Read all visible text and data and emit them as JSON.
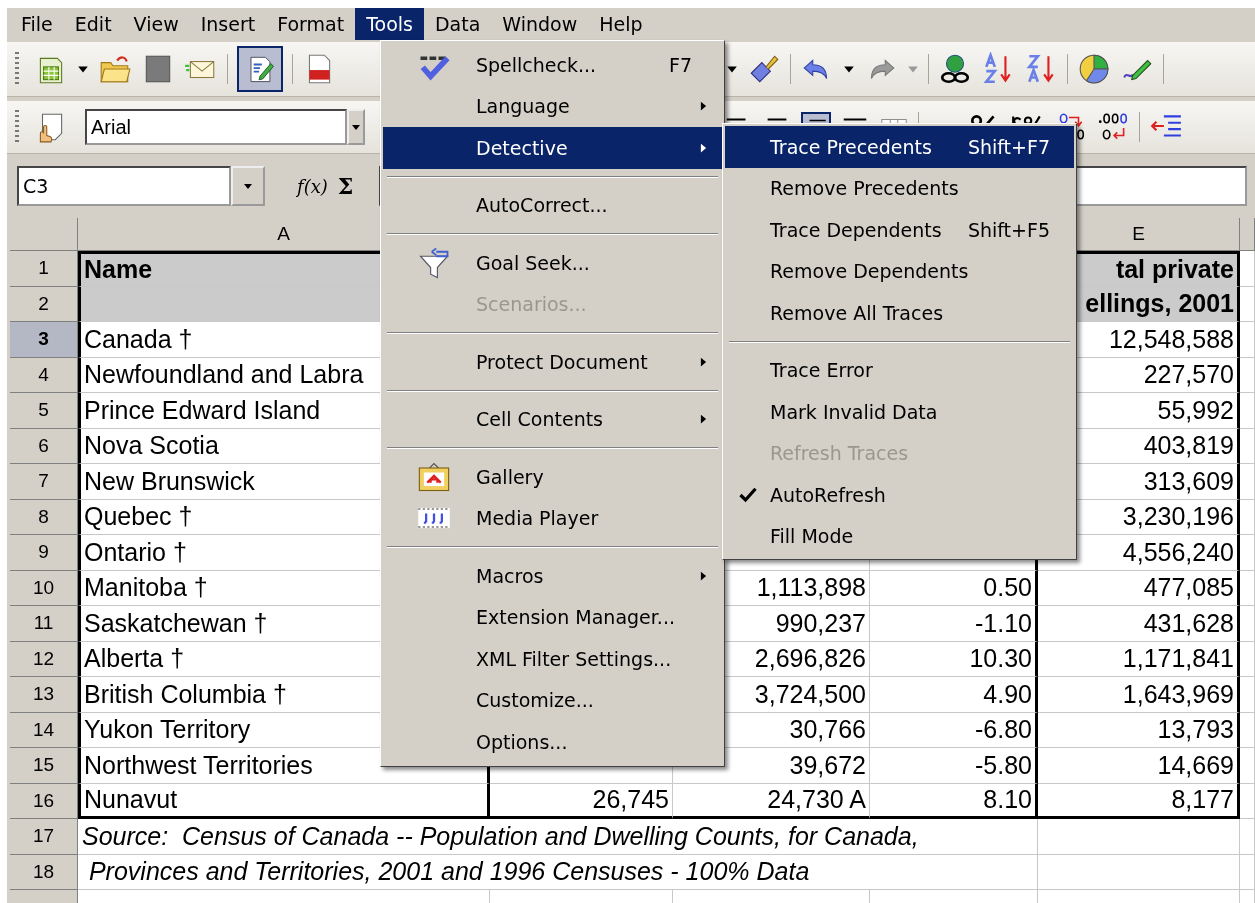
{
  "menubar": [
    {
      "label": "File",
      "selected": false
    },
    {
      "label": "Edit",
      "selected": false
    },
    {
      "label": "View",
      "selected": false
    },
    {
      "label": "Insert",
      "selected": false
    },
    {
      "label": "Format",
      "selected": false
    },
    {
      "label": "Tools",
      "selected": true
    },
    {
      "label": "Data",
      "selected": false
    },
    {
      "label": "Window",
      "selected": false
    },
    {
      "label": "Help",
      "selected": false
    }
  ],
  "standard_toolbar": {
    "edit_file_pressed": true,
    "redo_disabled": true
  },
  "formatting_toolbar": {
    "font_name": "Arial"
  },
  "formula_bar": {
    "name_box": "C3",
    "function_wizard": "f(x)",
    "sum_symbol": "Σ"
  },
  "column_headers": {
    "a": "A",
    "e": "E"
  },
  "rows": [
    {
      "header": "1",
      "selected": false,
      "kind": "heading",
      "a": "Name",
      "e": "tal private"
    },
    {
      "header": "2",
      "selected": false,
      "kind": "heading",
      "e": "ellings, 2001"
    },
    {
      "header": "3",
      "selected": true,
      "kind": "data",
      "a": "Canada †",
      "e": "12,548,588"
    },
    {
      "header": "4",
      "selected": false,
      "kind": "data",
      "a": "Newfoundland and Labra",
      "e": "227,570"
    },
    {
      "header": "5",
      "selected": false,
      "kind": "data",
      "a": "Prince Edward Island",
      "e": "55,992"
    },
    {
      "header": "6",
      "selected": false,
      "kind": "data",
      "a": "Nova Scotia",
      "e": "403,819"
    },
    {
      "header": "7",
      "selected": false,
      "kind": "data",
      "a": "New Brunswick",
      "e": "313,609"
    },
    {
      "header": "8",
      "selected": false,
      "kind": "data",
      "a": "Quebec †",
      "e": "3,230,196"
    },
    {
      "header": "9",
      "selected": false,
      "kind": "data",
      "a": "Ontario †",
      "e": "4,556,240"
    },
    {
      "header": "10",
      "selected": false,
      "kind": "data",
      "a": "Manitoba †",
      "c": "1,113,898",
      "d": "0.50",
      "e": "477,085"
    },
    {
      "header": "11",
      "selected": false,
      "kind": "data",
      "a": "Saskatchewan †",
      "c": "990,237",
      "d": "-1.10",
      "e": "431,628"
    },
    {
      "header": "12",
      "selected": false,
      "kind": "data",
      "a": "Alberta †",
      "c": "2,696,826",
      "d": "10.30",
      "e": "1,171,841"
    },
    {
      "header": "13",
      "selected": false,
      "kind": "data",
      "a": "British Columbia †",
      "c": "3,724,500",
      "d": "4.90",
      "e": "1,643,969"
    },
    {
      "header": "14",
      "selected": false,
      "kind": "data",
      "a": "Yukon Territory",
      "c": "30,766",
      "d": "-6.80",
      "e": "13,793"
    },
    {
      "header": "15",
      "selected": false,
      "kind": "data",
      "a": "Northwest Territories",
      "c": "39,672",
      "d": "-5.80",
      "e": "14,669"
    },
    {
      "header": "16",
      "selected": false,
      "kind": "data",
      "a": "Nunavut",
      "b": "26,745",
      "c": "24,730 A",
      "d": "8.10",
      "e": "8,177"
    },
    {
      "header": "17",
      "selected": false,
      "kind": "note",
      "a": "Source:  Census of Canada -- Population and Dwelling Counts, for Canada,"
    },
    {
      "header": "18",
      "selected": false,
      "kind": "note",
      "a": " Provinces and Territories, 2001 and 1996 Censuses - 100% Data"
    }
  ],
  "tools_menu": {
    "groups": [
      {
        "items": [
          {
            "label": "Spellcheck...",
            "shortcut": "F7",
            "has_submenu": false,
            "selected": false,
            "disabled": false
          },
          {
            "label": "Language",
            "has_submenu": true,
            "selected": false,
            "disabled": false
          },
          {
            "label": "Detective",
            "has_submenu": true,
            "selected": true,
            "disabled": false
          }
        ]
      },
      {
        "items": [
          {
            "label": "AutoCorrect...",
            "has_submenu": false,
            "selected": false,
            "disabled": false
          }
        ]
      },
      {
        "items": [
          {
            "label": "Goal Seek...",
            "has_submenu": false,
            "selected": false,
            "disabled": false
          },
          {
            "label": "Scenarios...",
            "has_submenu": false,
            "selected": false,
            "disabled": true
          }
        ]
      },
      {
        "items": [
          {
            "label": "Protect Document",
            "has_submenu": true,
            "selected": false,
            "disabled": false
          }
        ]
      },
      {
        "items": [
          {
            "label": "Cell Contents",
            "has_submenu": true,
            "selected": false,
            "disabled": false
          }
        ]
      },
      {
        "items": [
          {
            "label": "Gallery",
            "has_submenu": false,
            "selected": false,
            "disabled": false
          },
          {
            "label": "Media Player",
            "has_submenu": false,
            "selected": false,
            "disabled": false
          }
        ]
      },
      {
        "items": [
          {
            "label": "Macros",
            "has_submenu": true,
            "selected": false,
            "disabled": false
          },
          {
            "label": "Extension Manager...",
            "has_submenu": false,
            "selected": false,
            "disabled": false
          },
          {
            "label": "XML Filter Settings...",
            "has_submenu": false,
            "selected": false,
            "disabled": false
          },
          {
            "label": "Customize...",
            "has_submenu": false,
            "selected": false,
            "disabled": false
          },
          {
            "label": "Options...",
            "has_submenu": false,
            "selected": false,
            "disabled": false
          }
        ]
      }
    ]
  },
  "detective_submenu": {
    "groups": [
      {
        "items": [
          {
            "label": "Trace Precedents",
            "shortcut": "Shift+F7",
            "selected": true,
            "disabled": false,
            "checked": false
          },
          {
            "label": "Remove Precedents",
            "selected": false,
            "disabled": false,
            "checked": false
          },
          {
            "label": "Trace Dependents",
            "shortcut": "Shift+F5",
            "selected": false,
            "disabled": false,
            "checked": false
          },
          {
            "label": "Remove Dependents",
            "selected": false,
            "disabled": false,
            "checked": false
          },
          {
            "label": "Remove All Traces",
            "selected": false,
            "disabled": false,
            "checked": false
          }
        ]
      },
      {
        "items": [
          {
            "label": "Trace Error",
            "selected": false,
            "disabled": false,
            "checked": false
          },
          {
            "label": "Mark Invalid Data",
            "selected": false,
            "disabled": false,
            "checked": false
          },
          {
            "label": "Refresh Traces",
            "selected": false,
            "disabled": true,
            "checked": false
          },
          {
            "label": "AutoRefresh",
            "selected": false,
            "disabled": false,
            "checked": true
          },
          {
            "label": "Fill Mode",
            "selected": false,
            "disabled": false,
            "checked": false
          }
        ]
      }
    ]
  }
}
